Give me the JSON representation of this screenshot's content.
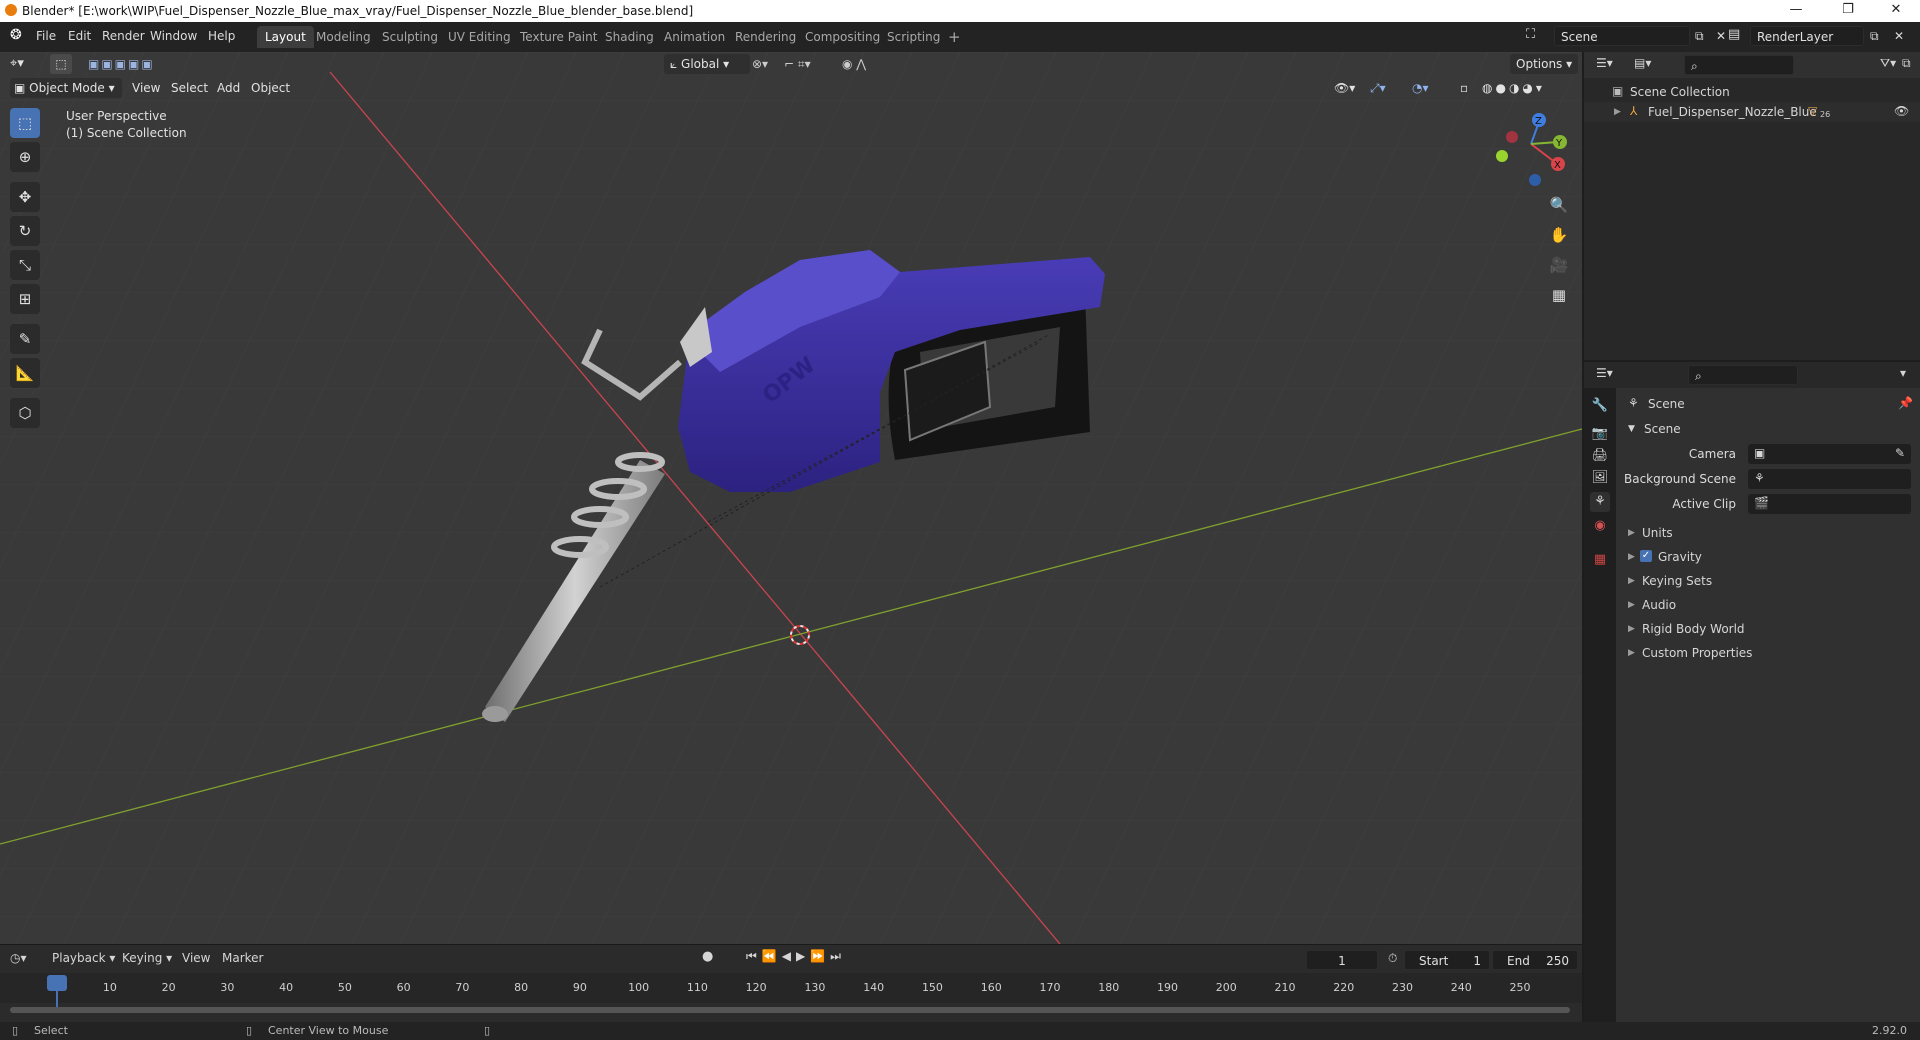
{
  "window": {
    "title": "Blender* [E:\\work\\WIP\\Fuel_Dispenser_Nozzle_Blue_max_vray/Fuel_Dispenser_Nozzle_Blue_blender_base.blend]",
    "minimize": "—",
    "maximize": "❐",
    "close": "✕"
  },
  "menu": [
    "File",
    "Edit",
    "Render",
    "Window",
    "Help"
  ],
  "workspaces": [
    "Layout",
    "Modeling",
    "Sculpting",
    "UV Editing",
    "Texture Paint",
    "Shading",
    "Animation",
    "Rendering",
    "Compositing",
    "Scripting"
  ],
  "active_workspace": "Layout",
  "add_workspace": "+",
  "scene_field": "Scene",
  "renderlayer_field": "RenderLayer",
  "viewport": {
    "mode": "Object Mode",
    "menus": [
      "View",
      "Select",
      "Add",
      "Object"
    ],
    "transform_orientation": "Global",
    "options": "Options",
    "overlay_line1": "User Perspective",
    "overlay_line2": "(1) Scene Collection",
    "model_logo": "OPW",
    "gizmo": {
      "x": "X",
      "y": "Y",
      "z": "Z"
    }
  },
  "timeline": {
    "menus": [
      "Playback",
      "Keying",
      "View",
      "Marker"
    ],
    "current_frame": "1",
    "start_label": "Start",
    "start": "1",
    "end_label": "End",
    "end": "250",
    "ticks": [
      "1",
      "10",
      "20",
      "30",
      "40",
      "50",
      "60",
      "70",
      "80",
      "90",
      "100",
      "110",
      "120",
      "130",
      "140",
      "150",
      "160",
      "170",
      "180",
      "190",
      "200",
      "210",
      "220",
      "230",
      "240",
      "250"
    ]
  },
  "statusbar": {
    "left": "Select",
    "middle": "Center View to Mouse",
    "version": "2.92.0"
  },
  "outliner": {
    "root": "Scene Collection",
    "item": "Fuel_Dispenser_Nozzle_Blue",
    "item_badge": "26"
  },
  "properties": {
    "context": "Scene",
    "panel": "Scene",
    "fields": [
      {
        "label": "Camera"
      },
      {
        "label": "Background Scene"
      },
      {
        "label": "Active Clip"
      }
    ],
    "sections": [
      "Units",
      "Gravity",
      "Keying Sets",
      "Audio",
      "Rigid Body World",
      "Custom Properties"
    ],
    "gravity_checked": true
  },
  "colors": {
    "accent": "#4772b3",
    "nozzle_body": "#3b2e9e",
    "x_axis": "#d9434a",
    "y_axis": "#86b732",
    "z_axis": "#3f7ee0"
  }
}
